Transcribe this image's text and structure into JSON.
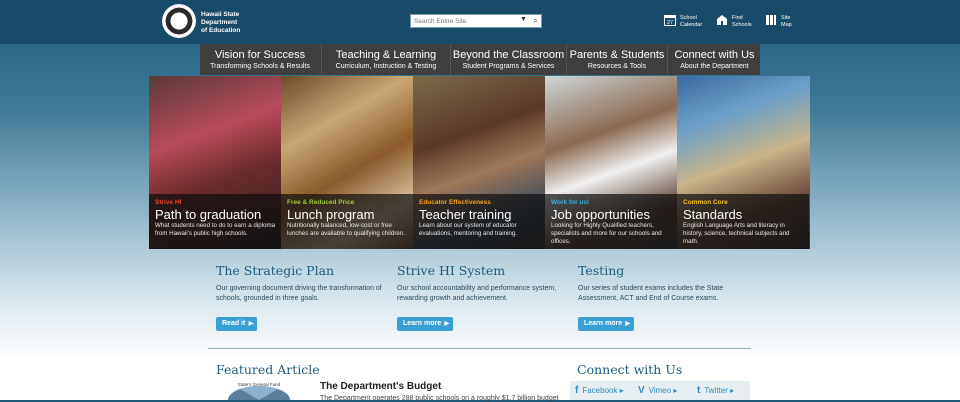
{
  "header": {
    "logo_text_line1": "Hawaii State",
    "logo_text_line2": "Department",
    "logo_text_line3": "of Education",
    "search_placeholder": "Search Entire Site",
    "utility": [
      {
        "label_line1": "School",
        "label_line2": "Calendar",
        "icon": "calendar-icon",
        "icon_text": "27"
      },
      {
        "label_line1": "Find",
        "label_line2": "Schools",
        "icon": "building-icon"
      },
      {
        "label_line1": "Site",
        "label_line2": "Map",
        "icon": "sitemap-icon"
      }
    ]
  },
  "nav": [
    {
      "title": "Vision for Success",
      "subtitle": "Transforming Schools & Results"
    },
    {
      "title": "Teaching & Learning",
      "subtitle": "Curriculum, Instruction & Testing"
    },
    {
      "title": "Beyond the Classroom",
      "subtitle": "Student Programs & Services"
    },
    {
      "title": "Parents & Students",
      "subtitle": "Resources & Tools"
    },
    {
      "title": "Connect with Us",
      "subtitle": "About the Department"
    }
  ],
  "hero": [
    {
      "tag": "Strive HI",
      "title": "Path to graduation",
      "desc": "What students need to do to earn a diploma from Hawaii's public high schools."
    },
    {
      "tag": "Free & Reduced Price",
      "title": "Lunch program",
      "desc": "Nutritionally balanced, low-cost or free lunches are available to qualifying children."
    },
    {
      "tag": "Educator Effectiveness",
      "title": "Teacher training",
      "desc": "Learn about our system of educator evaluations, mentoring and training."
    },
    {
      "tag": "Work for us!",
      "title": "Job opportunities",
      "desc": "Looking for Highly Qualified teachers, specialists and more for our schools and offices."
    },
    {
      "tag": "Common Core",
      "title": "Standards",
      "desc": "English Language Arts and literacy in history, science, technical subjects and math."
    }
  ],
  "sections": [
    {
      "title": "The Strategic Plan",
      "text": "Our governing document driving the transformation of schools, grounded in three goals.",
      "button": "Read it"
    },
    {
      "title": "Strive HI System",
      "text": "Our school accountability and performance system, rewarding growth and achievement.",
      "button": "Learn more"
    },
    {
      "title": "Testing",
      "text": "Our series of student exams includes the State Assessment, ACT and End of Course exams.",
      "button": "Learn more"
    }
  ],
  "featured": {
    "heading": "Featured Article",
    "thumb_caption": "State's General Fund",
    "title": "The Department's Budget",
    "text": "The Department operates 288 public schools on a roughly $1.7 billion budget"
  },
  "connect": {
    "heading": "Connect with Us",
    "links": [
      {
        "glyph": "f",
        "label": "Facebook",
        "icon": "facebook-icon"
      },
      {
        "glyph": "V",
        "label": "Vimeo",
        "icon": "vimeo-icon"
      },
      {
        "glyph": "t",
        "label": "Twitter",
        "icon": "twitter-icon"
      }
    ]
  },
  "colors": {
    "header_bg": "#184b69",
    "nav_bg": "#3f3f3f",
    "button_bg": "#3aa0d3",
    "heading": "#1d5a7d",
    "tag_colors": [
      "#e24a2f",
      "#9fcf3a",
      "#f4a21c",
      "#3ab0e3",
      "#f4c21c"
    ]
  }
}
